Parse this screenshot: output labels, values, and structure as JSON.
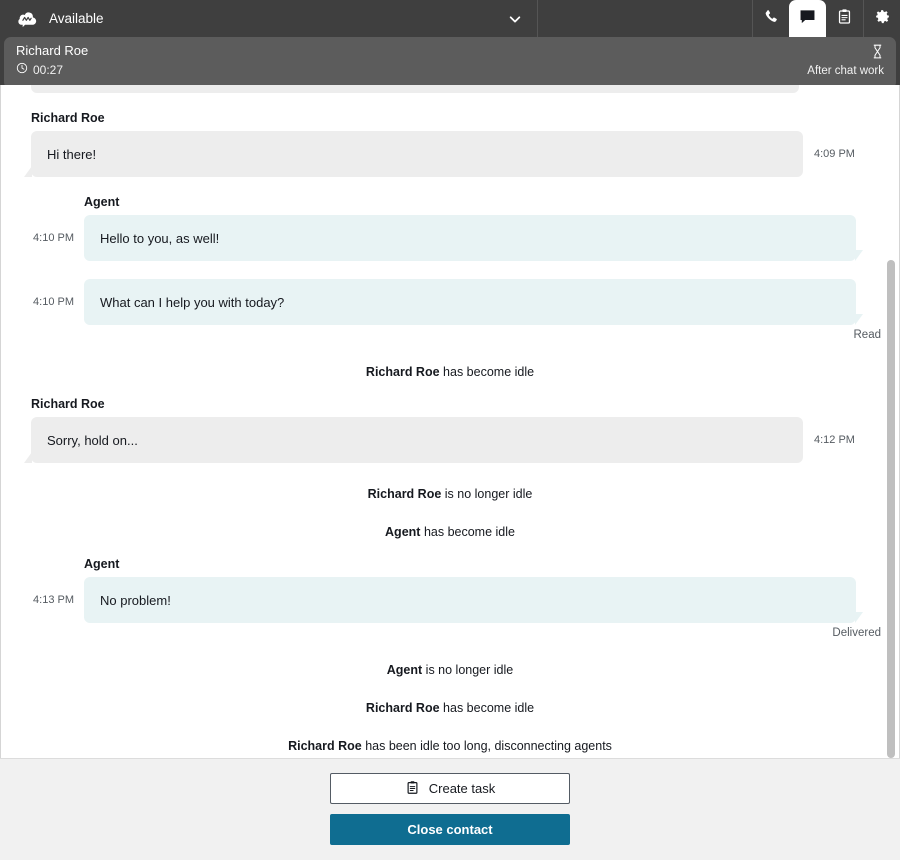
{
  "topbar": {
    "logo_icon": "amazon-connect-cloud-logo",
    "status_label": "Available",
    "chevron_icon": "chevron-down-icon",
    "tools": [
      {
        "icon": "phone-icon",
        "name": "phone",
        "active": false
      },
      {
        "icon": "chat-bubble-icon",
        "name": "chat",
        "active": true
      },
      {
        "icon": "clipboard-icon",
        "name": "tasks",
        "active": false
      },
      {
        "icon": "gear-icon",
        "name": "settings",
        "active": false
      }
    ]
  },
  "contact": {
    "name": "Richard Roe",
    "timer_icon": "clock-icon",
    "timer": "00:27",
    "state_icon": "hourglass-icon",
    "state_label": "After chat work"
  },
  "transcript": {
    "items": [
      {
        "kind": "clipped-bubble"
      },
      {
        "kind": "customer",
        "sender": "Richard Roe",
        "text": "Hi there!",
        "time": "4:09 PM"
      },
      {
        "kind": "agent",
        "sender": "Agent",
        "text": "Hello to you, as well!",
        "time": "4:10 PM",
        "receipt": ""
      },
      {
        "kind": "agent",
        "sender": "",
        "text": "What can I help you with today?",
        "time": "4:10 PM",
        "receipt": "Read"
      },
      {
        "kind": "system",
        "who": "Richard Roe",
        "what": "has become idle"
      },
      {
        "kind": "customer",
        "sender": "Richard Roe",
        "text": "Sorry, hold on...",
        "time": "4:12 PM"
      },
      {
        "kind": "system",
        "who": "Richard Roe",
        "what": "is no longer idle"
      },
      {
        "kind": "system",
        "who": "Agent",
        "what": "has become idle"
      },
      {
        "kind": "agent",
        "sender": "Agent",
        "text": "No problem!",
        "time": "4:13 PM",
        "receipt": "Delivered"
      },
      {
        "kind": "system",
        "who": "Agent",
        "what": "is no longer idle"
      },
      {
        "kind": "system",
        "who": "Richard Roe",
        "what": "has become idle"
      },
      {
        "kind": "system",
        "who": "Richard Roe",
        "what": "has been idle too long, disconnecting agents"
      }
    ],
    "scrollbar": {
      "thumb_top_pct": 26,
      "thumb_height_pct": 74
    }
  },
  "footer": {
    "create_task": {
      "icon": "clipboard-icon",
      "label": "Create task"
    },
    "close_contact": {
      "label": "Close contact"
    }
  },
  "colors": {
    "topbar_bg": "#3f3f3f",
    "contact_card_bg": "#5c5c5c",
    "customer_bubble": "#ededed",
    "agent_bubble": "#e8f3f4",
    "primary_button": "#0f6d91",
    "footer_bg": "#f1f1f1"
  }
}
